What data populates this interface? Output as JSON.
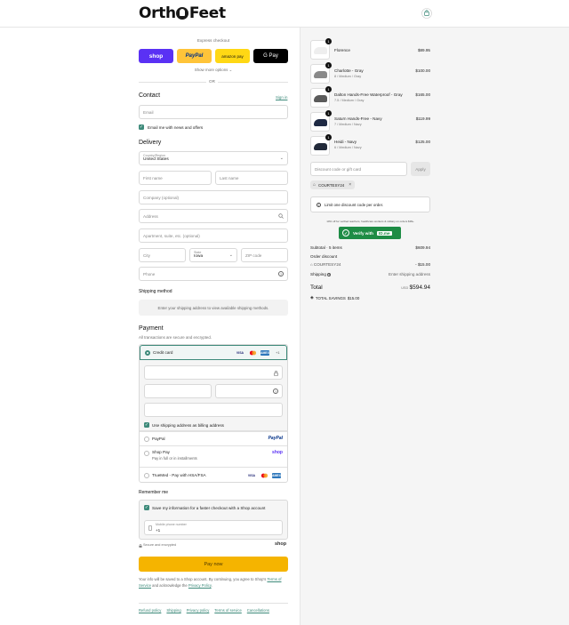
{
  "header": {
    "logo": "Orth",
    "logo_suffix": "Feet"
  },
  "express": {
    "label": "Express checkout",
    "shop": "shop",
    "paypal": "PayPal",
    "amazon": "amazon pay",
    "gpay": "G Pay",
    "more": "Show more options ⌄",
    "or": "OR"
  },
  "contact": {
    "title": "Contact",
    "sign_in": "Sign in",
    "email_placeholder": "Email",
    "news_label": "Email me with news and offers"
  },
  "delivery": {
    "title": "Delivery",
    "country_label": "Country/Region",
    "country_value": "United States",
    "first_name": "First name",
    "last_name": "Last name",
    "company": "Company (optional)",
    "address": "Address",
    "apartment": "Apartment, suite, etc. (optional)",
    "city": "City",
    "state_label": "State",
    "state_value": "Iowa",
    "zip": "ZIP code",
    "phone": "Phone"
  },
  "shipping": {
    "title": "Shipping method",
    "note": "Enter your shipping address to view available shipping methods."
  },
  "payment": {
    "title": "Payment",
    "subtitle": "All transactions are secure and encrypted.",
    "credit_card": "Credit card",
    "more_cards": "+1",
    "billing_label": "Use shipping address as billing address",
    "paypal": "PayPal",
    "shop_pay": "Shop Pay",
    "shop_pay_sub": "Pay in full or in installments",
    "truemed": "TrueMed - Pay with HSA/FSA"
  },
  "remember": {
    "title": "Remember me",
    "save_label": "Save my information for a faster checkout with a Shop account",
    "phone_label": "Mobile phone number",
    "phone_value": "+1",
    "secure": "Secure and encrypted",
    "shop": "shop"
  },
  "pay_now": "Pay now",
  "fine_print": {
    "pre": "Your info will be saved to a Shop account. By continuing, you agree to Shop's ",
    "terms": "Terms of Service",
    "mid": " and acknowledge the ",
    "privacy": "Privacy Policy",
    "post": "."
  },
  "footer": [
    "Refund policy",
    "Shipping",
    "Privacy policy",
    "Terms of service",
    "Cancellations"
  ],
  "cart": {
    "items": [
      {
        "qty": "1",
        "name": "Florence",
        "variant": "",
        "price": "$89.95"
      },
      {
        "qty": "1",
        "name": "Charlotte - Gray",
        "variant": "8 / Medium / Gray",
        "price": "$100.00"
      },
      {
        "qty": "1",
        "name": "Dalton Hands-Free Waterproof - Gray",
        "variant": "7.5 / Medium / Gray",
        "price": "$165.00"
      },
      {
        "qty": "1",
        "name": "Saturn Hands-Free - Navy",
        "variant": "7 / Medium / Navy",
        "price": "$119.99"
      },
      {
        "qty": "1",
        "name": "Heidi - Navy",
        "variant": "6 / Medium / Navy",
        "price": "$125.00"
      }
    ],
    "discount_placeholder": "Discount code or gift card",
    "apply": "Apply",
    "code": "COURTESY24",
    "limit_note": "Limit one discount code per order.",
    "idme_note": "10% off for verified teachers, healthcare workers & military on orders $99+",
    "verify": "Verify with",
    "idme": "ID.me",
    "subtotal_label": "Subtotal · 5 items",
    "subtotal_value": "$609.94",
    "order_discount": "Order discount",
    "discount_code": "COURTESY24",
    "discount_value": "- $15.00",
    "shipping_label": "Shipping",
    "shipping_value": "Enter shipping address",
    "total_label": "Total",
    "currency": "USD",
    "total_value": "$594.94",
    "savings_label": "TOTAL SAVINGS",
    "savings_value": "$15.00"
  },
  "colors": {
    "accent": "#3d8a7a",
    "pay_now": "#f5b400",
    "shop_purple": "#5a31f4"
  }
}
